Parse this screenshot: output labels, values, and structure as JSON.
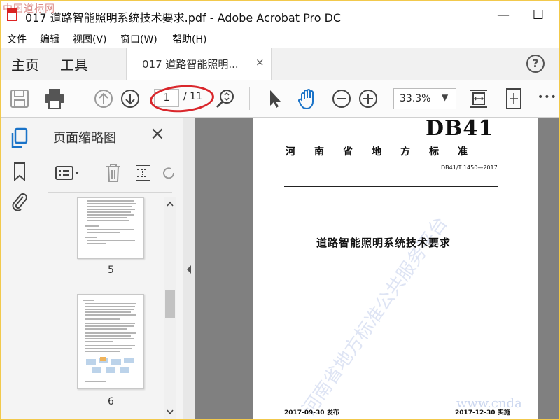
{
  "window": {
    "title": "017 道路智能照明系统技术要求.pdf - Adobe Acrobat Pro DC",
    "minimize": "—",
    "maximize": "☐"
  },
  "watermark_site": "中国道标网",
  "menu": [
    "文件",
    "编辑",
    "视图(V)",
    "窗口(W)",
    "帮助(H)"
  ],
  "nav": {
    "home": "主页",
    "tools": "工具",
    "doc_tab": "017 道路智能照明...",
    "doc_tab_close": "×",
    "help": "?"
  },
  "toolbar": {
    "page_current": "1",
    "page_total": "/ 11",
    "zoom": "33.3%",
    "zoom_caret": "▼",
    "more": "•••"
  },
  "panel": {
    "title": "页面缩略图",
    "close": "×",
    "thumbnails": [
      {
        "label": "5"
      },
      {
        "label": "6"
      }
    ]
  },
  "document": {
    "code": "DB41",
    "region": "河南省地方标准",
    "number": "DB41/T 1450—2017",
    "title": "道路智能照明系统技术要求",
    "publish_date": "2017-09-30 发布",
    "implement_date": "2017-12-30 实施",
    "watermark_diagonal": "河南省地方标准公共服务平台",
    "watermark_url": "www.cnda"
  },
  "colors": {
    "border_highlight": "#f2c94c",
    "annotation_circle": "#d9262b",
    "active_blue": "#1a73c8"
  }
}
